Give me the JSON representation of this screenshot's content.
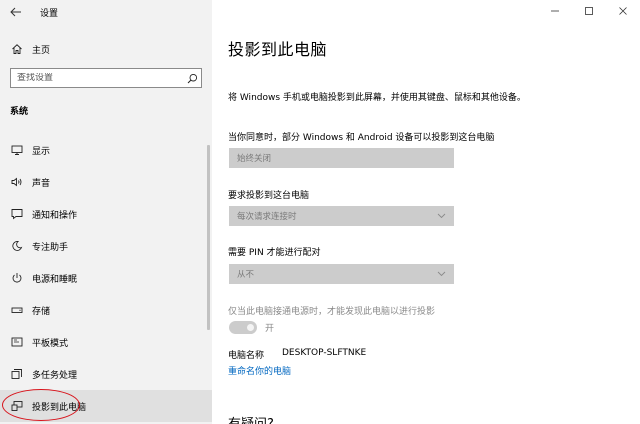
{
  "window": {
    "app_title": "设置",
    "controls": {
      "minimize": "minimize-icon",
      "maximize": "maximize-icon",
      "close": "close-icon"
    }
  },
  "sidebar": {
    "home_label": "主页",
    "search_placeholder": "查找设置",
    "section_header": "系统",
    "items": [
      {
        "label": "显示",
        "icon": "display-icon"
      },
      {
        "label": "声音",
        "icon": "sound-icon"
      },
      {
        "label": "通知和操作",
        "icon": "notification-icon"
      },
      {
        "label": "专注助手",
        "icon": "focus-assist-icon"
      },
      {
        "label": "电源和睡眠",
        "icon": "power-icon"
      },
      {
        "label": "存储",
        "icon": "storage-icon"
      },
      {
        "label": "平板模式",
        "icon": "tablet-icon"
      },
      {
        "label": "多任务处理",
        "icon": "multitasking-icon"
      },
      {
        "label": "投影到此电脑",
        "icon": "projection-icon",
        "active": true
      }
    ],
    "highlight_color": "#d8141c"
  },
  "main": {
    "title": "投影到此电脑",
    "intro": "将 Windows 手机或电脑投影到此屏幕，并使用其键盘、鼠标和其他设备。",
    "setting1": {
      "label": "当你同意时，部分 Windows 和 Android 设备可以投影到这台电脑",
      "value": "始终关闭"
    },
    "setting2": {
      "label": "要求投影到这台电脑",
      "value": "每次请求连接时"
    },
    "setting3": {
      "label": "需要 PIN 才能进行配对",
      "value": "从不"
    },
    "power_setting": {
      "label": "仅当此电脑接通电源时，才能发现此电脑以进行投影",
      "toggle_text": "开",
      "state": "on-disabled"
    },
    "pc_name_label": "电脑名称",
    "pc_name_value": "DESKTOP-SLFTNKE",
    "rename_link": "重命名你的电脑",
    "faq_title": "有疑问?",
    "link_color": "#0067c0"
  }
}
